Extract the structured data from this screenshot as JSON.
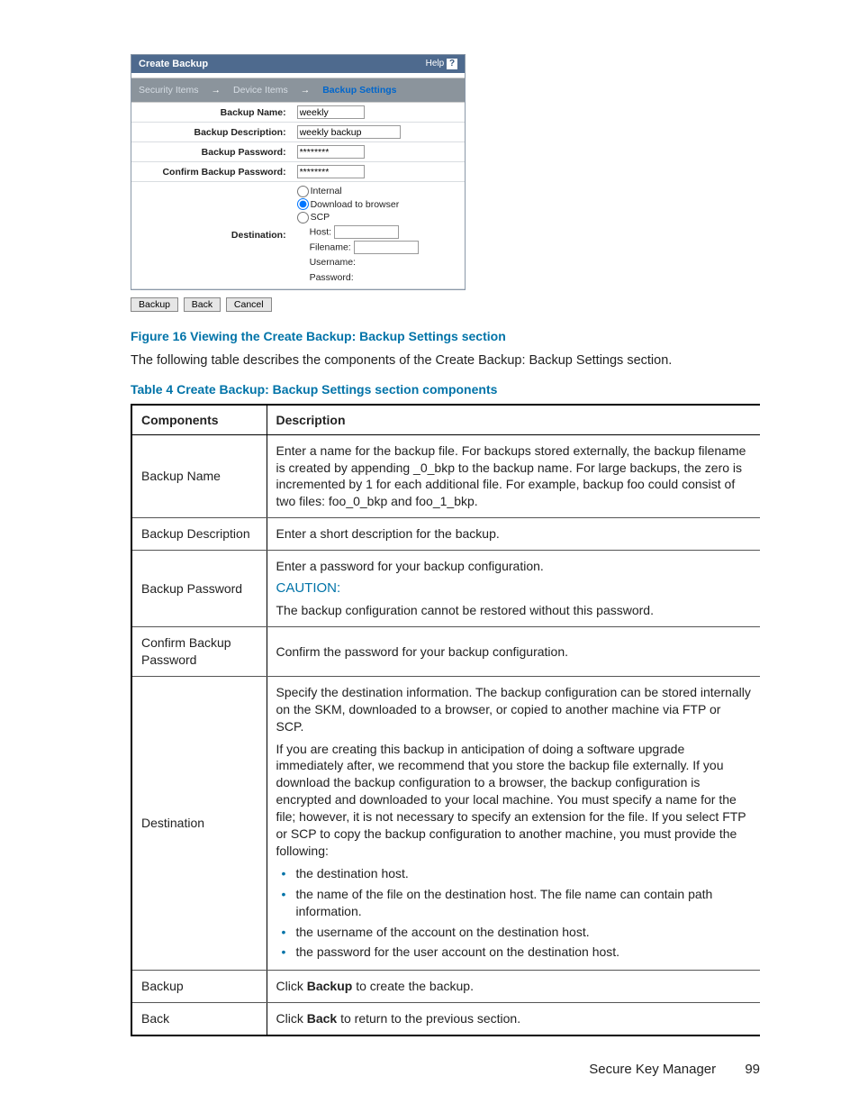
{
  "panel": {
    "title": "Create Backup",
    "help_label": "Help",
    "wizard": {
      "step1": "Security Items",
      "step2": "Device Items",
      "step3": "Backup Settings"
    },
    "fields": {
      "name_label": "Backup Name:",
      "name_value": "weekly",
      "desc_label": "Backup Description:",
      "desc_value": "weekly backup",
      "pw_label": "Backup Password:",
      "pw_value": "********",
      "cpw_label": "Confirm Backup Password:",
      "cpw_value": "********",
      "dest_label": "Destination:"
    },
    "dest": {
      "opt_internal": "Internal",
      "opt_download": "Download to browser",
      "opt_scp": "SCP",
      "host": "Host:",
      "filename": "Filename:",
      "username": "Username:",
      "password": "Password:"
    },
    "buttons": {
      "backup": "Backup",
      "back": "Back",
      "cancel": "Cancel"
    }
  },
  "doc": {
    "fig_caption": "Figure 16 Viewing the Create Backup: Backup Settings section",
    "intro": "The following table describes the components of the Create Backup: Backup Settings section.",
    "table_caption": "Table 4 Create Backup: Backup Settings section components",
    "headers": {
      "col1": "Components",
      "col2": "Description"
    },
    "rows": {
      "r1c1": "Backup Name",
      "r1c2": "Enter a name for the backup file. For backups stored externally, the backup filename is created by appending _0_bkp to the backup name. For large backups, the zero is incremented by 1 for each additional file. For example, backup foo could consist of two files: foo_0_bkp and foo_1_bkp.",
      "r2c1": "Backup Description",
      "r2c2": "Enter a short description for the backup.",
      "r3c1": "Backup Password",
      "r3c2a": "Enter a password for your backup configuration.",
      "r3caution": "CAUTION:",
      "r3c2b": "The backup configuration cannot be restored without this password.",
      "r4c1": "Confirm Backup Password",
      "r4c2": "Confirm the password for your backup configuration.",
      "r5c1": "Destination",
      "r5p1": "Specify the destination information. The backup configuration can be stored internally on the SKM, downloaded to a browser, or copied to another machine via FTP or SCP.",
      "r5p2": "If you are creating this backup in anticipation of doing a software upgrade immediately after, we recommend that you store the backup file externally. If you download the backup configuration to a browser, the backup configuration is encrypted and downloaded to your local machine. You must specify a name for the file; however, it is not necessary to specify an extension for the file. If you select FTP or SCP to copy the backup configuration to another machine, you must provide the following:",
      "r5li1": "the destination host.",
      "r5li2": "the name of the file on the destination host. The file name can contain path information.",
      "r5li3": "the username of the account on the destination host.",
      "r5li4": "the password for the user account on the destination host.",
      "r6c1": "Backup",
      "r6pre": "Click ",
      "r6bold": "Backup",
      "r6post": " to create the backup.",
      "r7c1": "Back",
      "r7pre": "Click ",
      "r7bold": "Back",
      "r7post": " to return to the previous section."
    },
    "footer_text": "Secure Key Manager",
    "page_number": "99"
  }
}
